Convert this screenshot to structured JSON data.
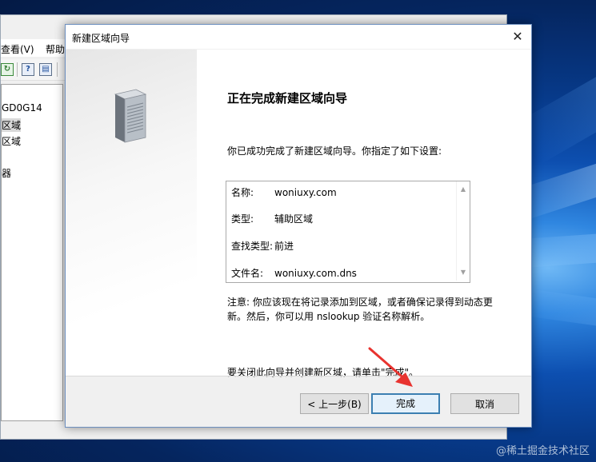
{
  "mmc": {
    "menus": [
      "查看(V)",
      "帮助"
    ],
    "tree_items": [
      "GD0G14",
      "区域",
      "区域",
      "器"
    ]
  },
  "wizard": {
    "title": "新建区域向导",
    "close_glyph": "✕",
    "heading": "正在完成新建区域向导",
    "intro": "你已成功完成了新建区域向导。你指定了如下设置:",
    "summary": [
      {
        "label": "名称:",
        "value": "woniuxy.com"
      },
      {
        "label": "类型:",
        "value": "辅助区域"
      },
      {
        "label": "查找类型:",
        "value": "前进"
      },
      {
        "label": "文件名:",
        "value": "woniuxy.com.dns"
      }
    ],
    "note_line1": "注意: 你应该现在将记录添加到区域，或者确保记录得到动态更",
    "note_line2": "新。然后，你可以用 nslookup 验证名称解析。",
    "close_hint": "要关闭此向导并创建新区域，请单击\"完成\"。",
    "buttons": {
      "back": "< 上一步(B)",
      "finish": "完成",
      "cancel": "取消"
    }
  },
  "watermark": "@稀土掘金技术社区",
  "colors": {
    "annotation_arrow": "#e8332f",
    "default_button_border": "#3c7fb1"
  },
  "icons": {
    "refresh": "refresh-icon",
    "help": "help-icon",
    "properties": "properties-icon",
    "server": "server-icon",
    "close": "close-icon"
  }
}
